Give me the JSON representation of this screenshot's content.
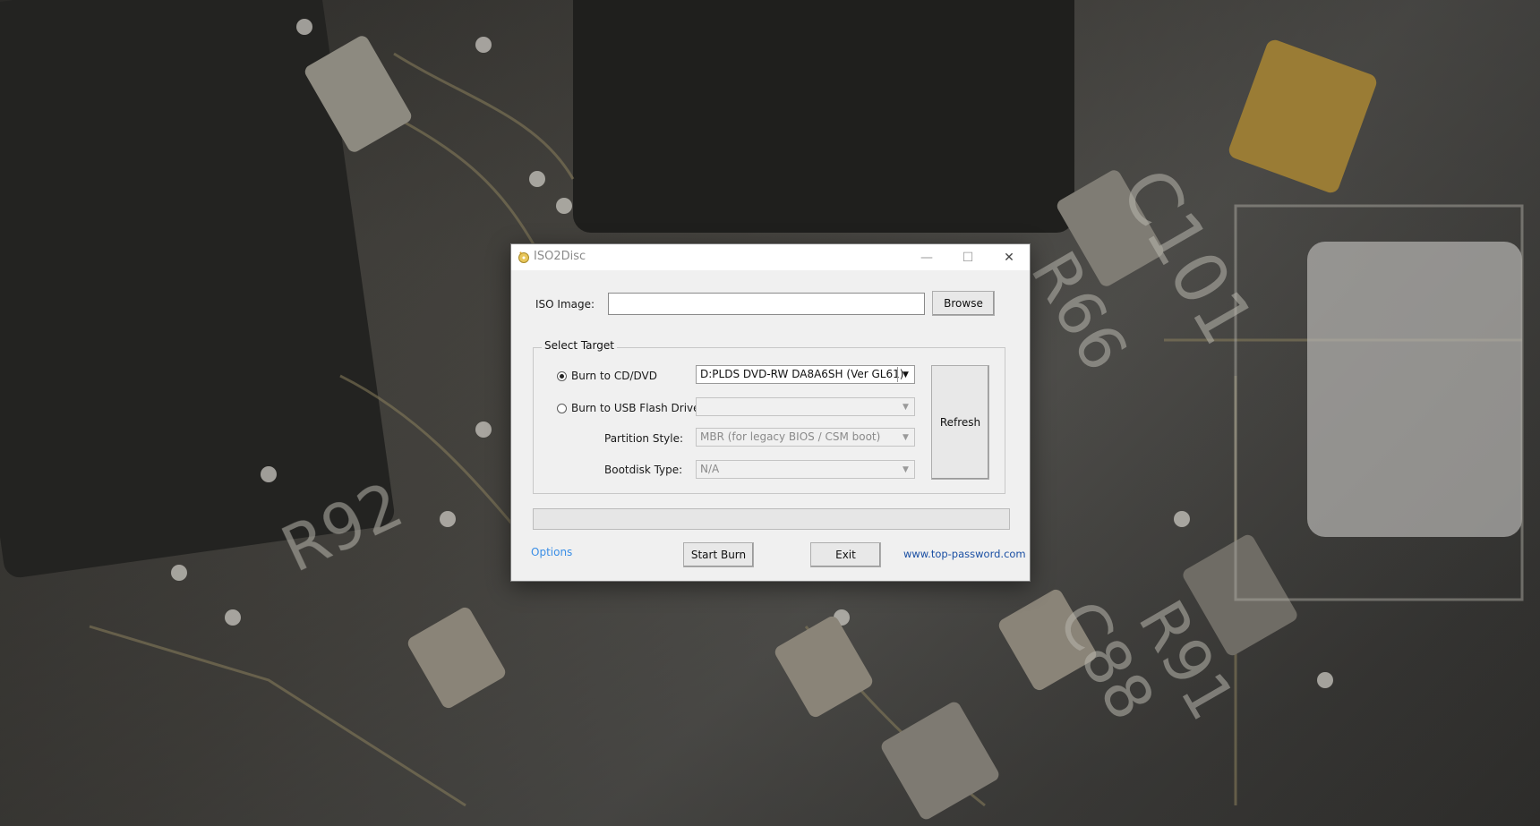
{
  "window": {
    "title": "ISO2Disc",
    "minimize_glyph": "—",
    "maximize_glyph": "☐",
    "close_glyph": "✕",
    "app_icon": "disc-burn-icon"
  },
  "iso_image": {
    "label": "ISO Image:",
    "value": "",
    "browse_label": "Browse"
  },
  "select_target": {
    "title": "Select Target",
    "cd_dvd": {
      "label": "Burn to CD/DVD",
      "selected": true,
      "drive": "D:PLDS DVD-RW DA8A6SH (Ver GL61)"
    },
    "usb": {
      "label": "Burn to USB Flash Drive",
      "selected": false,
      "drive": ""
    },
    "partition_style": {
      "label": "Partition Style:",
      "value": "MBR (for legacy BIOS / CSM boot)"
    },
    "bootdisk_type": {
      "label": "Bootdisk Type:",
      "value": "N/A"
    },
    "refresh_label": "Refresh"
  },
  "footer": {
    "options_label": "Options",
    "start_burn_label": "Start Burn",
    "exit_label": "Exit",
    "website_label": "www.top-password.com"
  },
  "progress": 0,
  "colors": {
    "link_light": "#3a8ee6",
    "link_dark": "#1a4fa3",
    "window_bg": "#f0f0f0"
  }
}
